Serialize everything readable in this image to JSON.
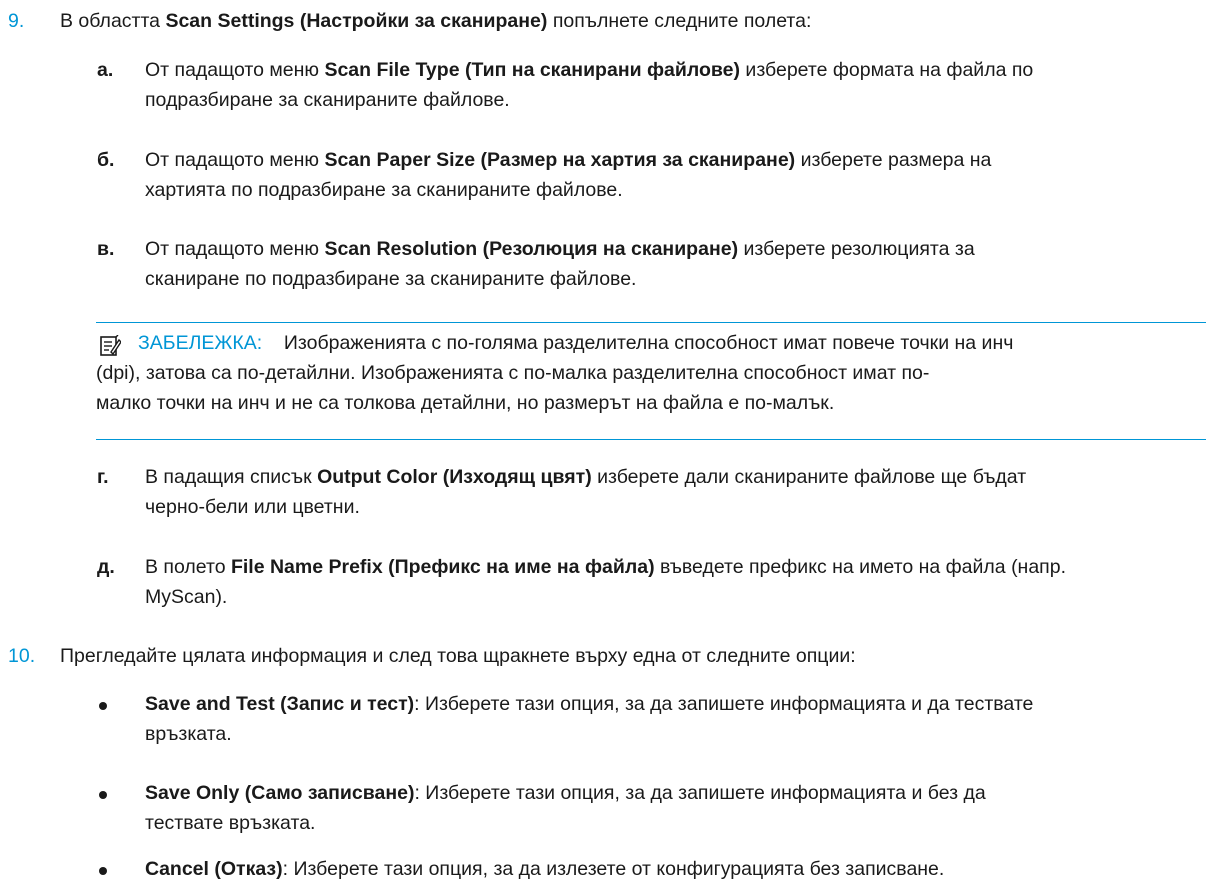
{
  "step9": {
    "number": "9.",
    "pre": "В областта ",
    "bold": "Scan Settings (Настройки за сканиране)",
    "post": " попълнете следните полета:"
  },
  "sub_a": {
    "letter": "а.",
    "pre": "От падащото меню ",
    "bold": "Scan File Type (Тип на сканирани файлове)",
    "post": " изберете формата на файла по",
    "line2": "подразбиране за сканираните файлове."
  },
  "sub_b": {
    "letter": "б.",
    "pre": "От падащото меню ",
    "bold": "Scan Paper Size (Размер на хартия за сканиране)",
    "post": " изберете размера на",
    "line2": "хартията по подразбиране за сканираните файлове."
  },
  "sub_v": {
    "letter": "в.",
    "pre": "От падащото меню ",
    "bold": "Scan Resolution (Резолюция на сканиране)",
    "post": " изберете резолюцията за",
    "line2": "сканиране по подразбиране за сканираните файлове."
  },
  "note": {
    "label": "ЗАБЕЛЕЖКА:",
    "line1": "Изображенията с по-голяма разделителна способност имат повече точки на инч",
    "line2": "(dpi), затова са по-детайлни. Изображенията с по-малка разделителна способност имат по-",
    "line3": "малко точки на инч и не са толкова детайлни, но размерът на файла е по-малък."
  },
  "sub_g": {
    "letter": "г.",
    "pre": "В падащия списък ",
    "bold": "Output Color (Изходящ цвят)",
    "post": " изберете дали сканираните файлове ще бъдат",
    "line2": "черно-бели или цветни."
  },
  "sub_d": {
    "letter": "д.",
    "pre": "В полето ",
    "bold": "File Name Prefix (Префикс на име на файла)",
    "post": " въведете префикс на името на файла (напр.",
    "line2": "MyScan)."
  },
  "step10": {
    "number": "10.",
    "text": "Прегледайте цялата информация и след това щракнете върху една от следните опции:"
  },
  "options": [
    {
      "bold": "Save and Test (Запис и тест)",
      "post": ": Изберете тази опция, за да запишете информацията и да тествате",
      "line2": "връзката."
    },
    {
      "bold": "Save Only (Само записване)",
      "post": ": Изберете тази опция, за да запишете информацията и без да",
      "line2": "тествате връзката."
    },
    {
      "bold": "Cancel (Отказ)",
      "post": ": Изберете тази опция, за да излезете от конфигурацията без записване.",
      "line2": ""
    }
  ],
  "colors": {
    "accent": "#0096d6",
    "text": "#1a1a1a"
  }
}
